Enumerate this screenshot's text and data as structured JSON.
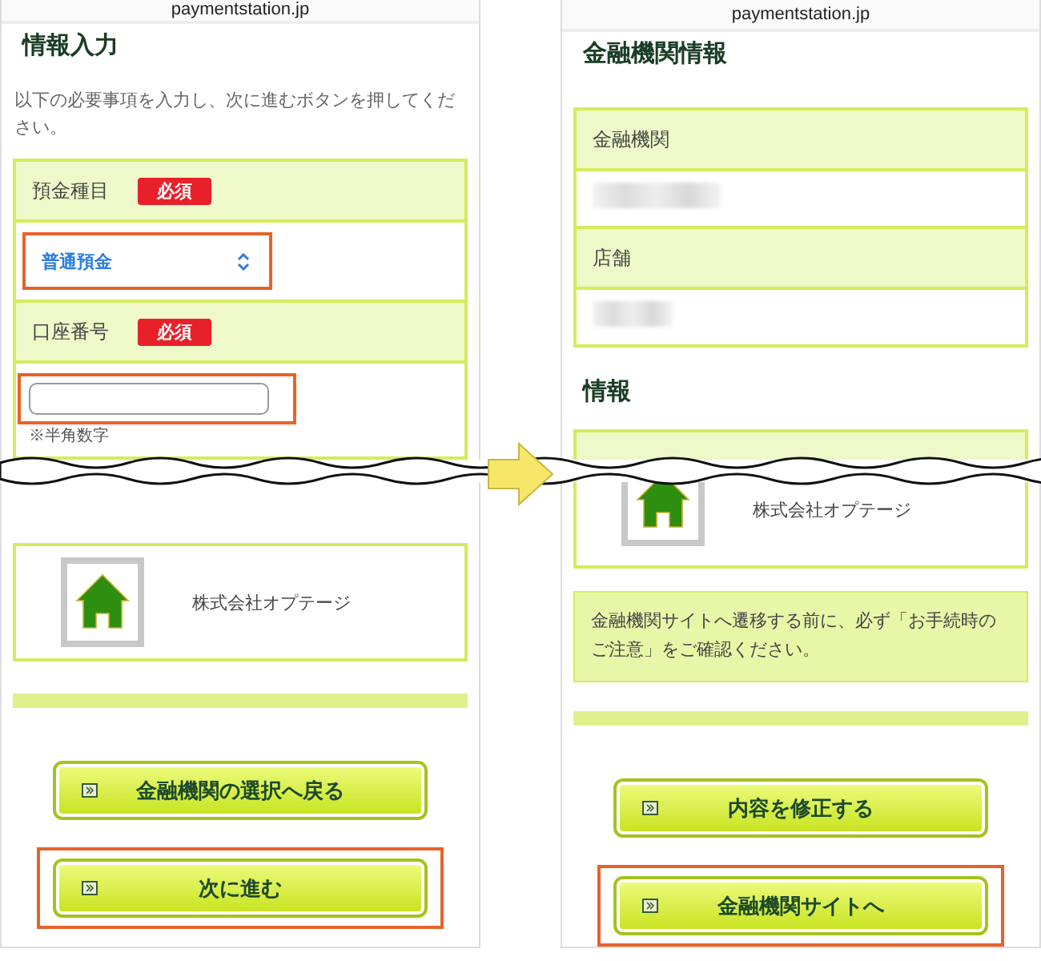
{
  "left_screen": {
    "url": "paymentstation.jp",
    "title": "情報入力",
    "instructions": "以下の必要事項を入力し、次に進むボタンを押してください。",
    "fields": [
      {
        "kind": "select",
        "label": "預金種目",
        "badge": "必須",
        "value": "普通預金",
        "highlighted": true
      },
      {
        "kind": "text",
        "label": "口座番号",
        "badge": "必須",
        "hint": "※半角数字",
        "highlighted": true
      }
    ],
    "company": "株式会社オプテージ",
    "buttons": [
      {
        "label": "金融機関の選択へ戻る",
        "highlighted": false
      },
      {
        "label": "次に進む",
        "highlighted": true
      }
    ]
  },
  "right_screen": {
    "url": "paymentstation.jp",
    "title": "金融機関情報",
    "rows": [
      {
        "label": "金融機関"
      },
      {
        "label": "店舗"
      }
    ],
    "section_title": "情報",
    "company": "株式会社オプテージ",
    "notice": "金融機関サイトへ遷移する前に、必ず「お手続時のご注意」をご確認ください。",
    "buttons": [
      {
        "label": "内容を修正する",
        "highlighted": false
      },
      {
        "label": "金融機関サイトへ",
        "highlighted": true
      }
    ]
  }
}
